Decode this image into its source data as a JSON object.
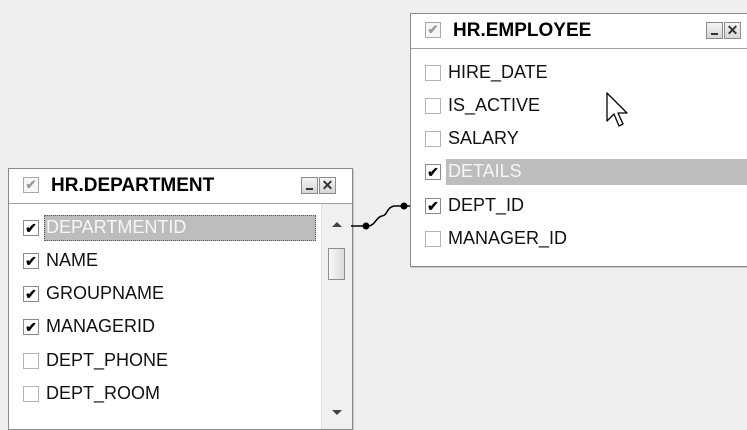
{
  "employee": {
    "title": "HR.EMPLOYEE",
    "columns": [
      {
        "name": "HIRE_DATE",
        "checked": false,
        "selected": false
      },
      {
        "name": "IS_ACTIVE",
        "checked": false,
        "selected": false
      },
      {
        "name": "SALARY",
        "checked": false,
        "selected": false
      },
      {
        "name": "DETAILS",
        "checked": true,
        "selected": true
      },
      {
        "name": "DEPT_ID",
        "checked": true,
        "selected": false
      },
      {
        "name": "MANAGER_ID",
        "checked": false,
        "selected": false
      }
    ]
  },
  "department": {
    "title": "HR.DEPARTMENT",
    "columns": [
      {
        "name": "DEPARTMENTID",
        "checked": true,
        "selected": true
      },
      {
        "name": "NAME",
        "checked": true,
        "selected": false
      },
      {
        "name": "GROUPNAME",
        "checked": true,
        "selected": false
      },
      {
        "name": "MANAGERID",
        "checked": true,
        "selected": false
      },
      {
        "name": "DEPT_PHONE",
        "checked": false,
        "selected": false
      },
      {
        "name": "DEPT_ROOM",
        "checked": false,
        "selected": false
      }
    ]
  },
  "glyphs": {
    "check": "✔",
    "close": "✕"
  },
  "colors": {
    "background": "#efefef",
    "selection": "#bdbdbd",
    "connector": "#000000"
  }
}
